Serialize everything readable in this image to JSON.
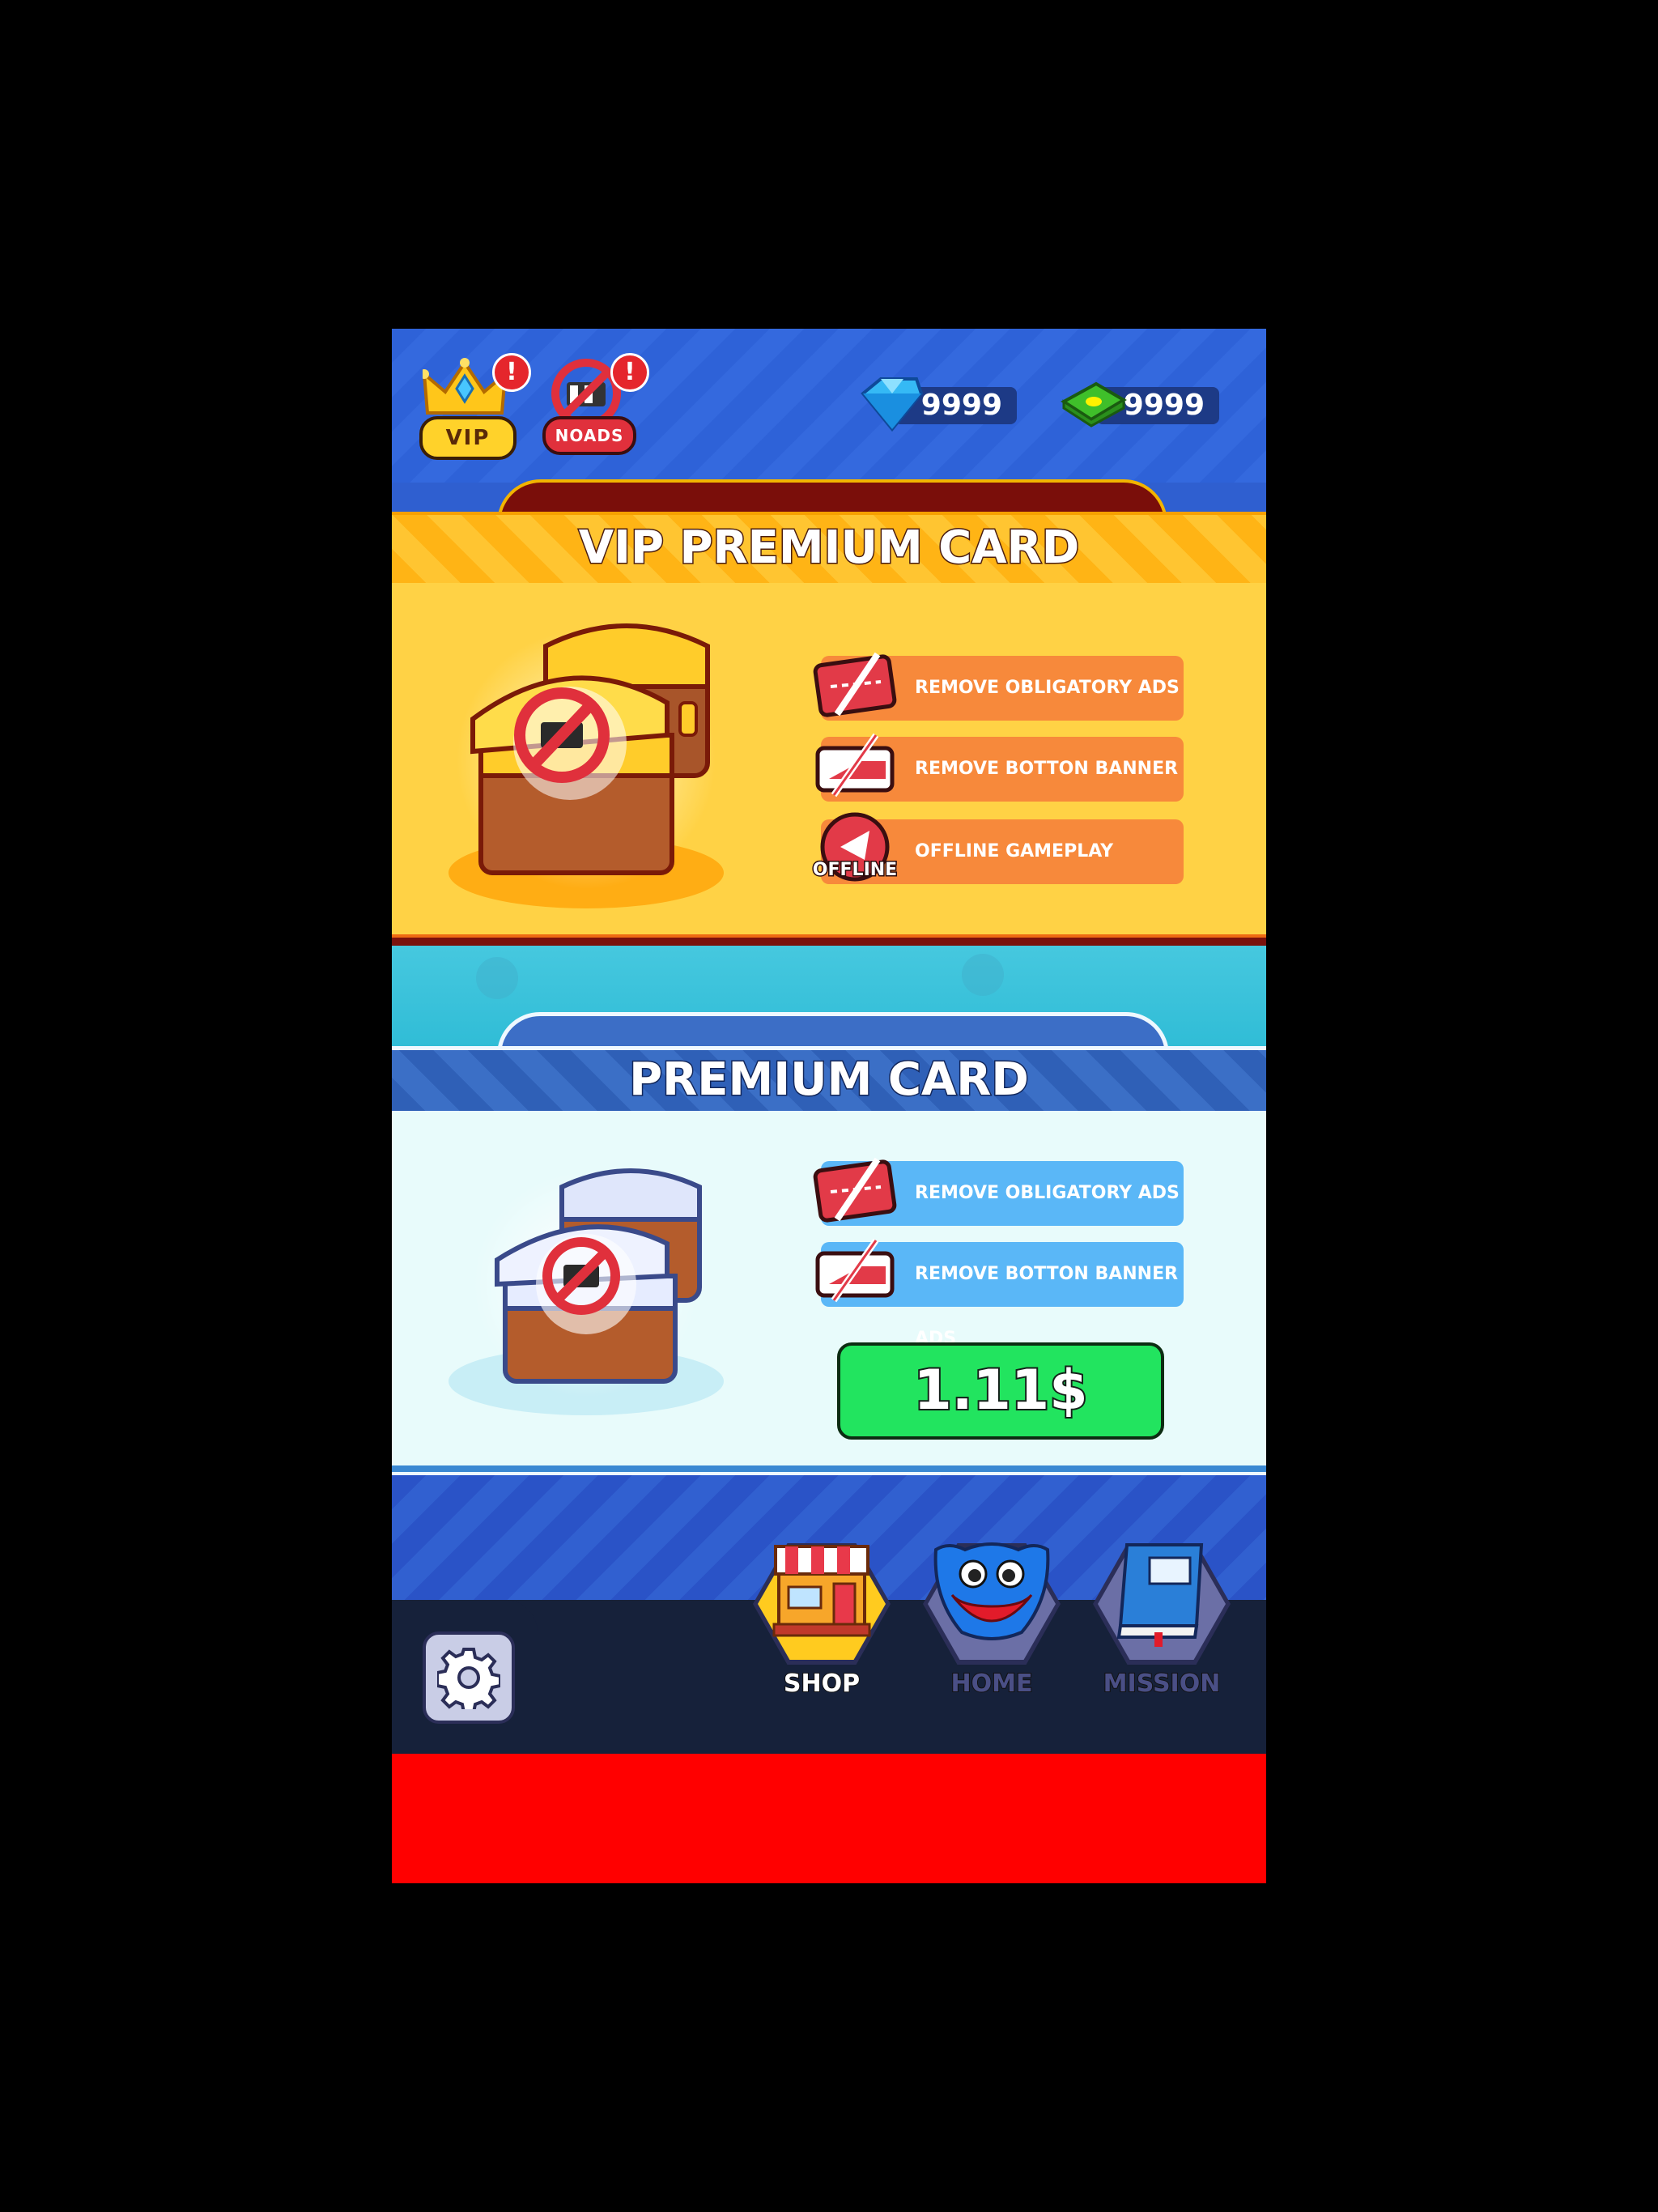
{
  "topbar": {
    "vip_label": "VIP",
    "noads_label": "NOADS",
    "alert_mark": "!",
    "gems": "9999",
    "cash": "9999"
  },
  "vip_card": {
    "title": "VIP PREMIUM CARD",
    "features": [
      {
        "label": "REMOVE OBLIGATORY ADS",
        "icon": "no-ticket-icon"
      },
      {
        "label": "REMOVE BOTTON BANNER ADS",
        "icon": "no-banner-icon"
      },
      {
        "label": "OFFLINE GAMEPLAY",
        "icon": "offline-play-icon",
        "icon_text": "OFFLINE"
      }
    ]
  },
  "premium_card": {
    "title": "PREMIUM CARD",
    "features": [
      {
        "label": "REMOVE OBLIGATORY ADS",
        "icon": "no-ticket-icon"
      },
      {
        "label": "REMOVE BOTTON BANNER ADS",
        "icon": "no-banner-icon"
      }
    ],
    "price": "1.11$"
  },
  "nav": {
    "shop": "SHOP",
    "home": "HOME",
    "mission": "MISSION",
    "active": "shop"
  },
  "colors": {
    "vip_accent": "#ffd245",
    "premium_accent": "#5ab7f7",
    "buy_button": "#22e45f",
    "ad_placeholder": "#ff0000"
  }
}
